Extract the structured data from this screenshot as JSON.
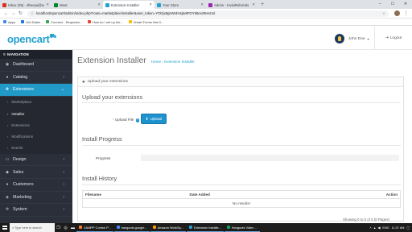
{
  "browser": {
    "tabs": [
      {
        "title": "Inbox (25) - dheeya@wolfspo",
        "favicon_color": "#d93025",
        "active": false
      },
      {
        "title": "Meet",
        "favicon_color": "#00832d",
        "active": false
      },
      {
        "title": "Extension Installer",
        "favicon_color": "#23a1d1",
        "active": true
      },
      {
        "title": "Your Store",
        "favicon_color": "#23a1d1",
        "active": false
      },
      {
        "title": "Admin - InvisiReferrals",
        "favicon_color": "#9c27b0",
        "active": false
      }
    ],
    "url": "localhost/opencart/admin/index.php?route=marketplace/installer&user_token=YOlzjx8gmW4Hsjtu9FOY36exz9HeCel",
    "bookmarks": [
      {
        "label": "Apps",
        "color": "#4285f4"
      },
      {
        "label": "Get Dates",
        "color": "#1a73e8"
      },
      {
        "label": "Connect - Requesta...",
        "color": "#34a853"
      },
      {
        "label": "How do I set up the...",
        "color": "#ea4335"
      },
      {
        "label": "Smart Forms that li...",
        "color": "#fbbc05"
      }
    ]
  },
  "header": {
    "logo_text": "opencart",
    "user_name": "John Doe",
    "logout_label": "Logout"
  },
  "sidebar": {
    "heading": "NAVIGATION",
    "items_top": [
      {
        "label": "Dashboard",
        "icon": "dashboard-icon",
        "glyph": "◉",
        "has_children": false
      },
      {
        "label": "Catalog",
        "icon": "tag-icon",
        "glyph": "●",
        "has_children": true
      }
    ],
    "active_item": {
      "label": "Extensions",
      "icon": "puzzle-icon",
      "glyph": "✚"
    },
    "sub_items": [
      {
        "label": "Marketplace",
        "current": false
      },
      {
        "label": "Installer",
        "current": true
      },
      {
        "label": "Extensions",
        "current": false
      },
      {
        "label": "Modifications",
        "current": false
      },
      {
        "label": "Events",
        "current": false
      }
    ],
    "items_bottom": [
      {
        "label": "Design",
        "icon": "desktop-icon",
        "glyph": "▭"
      },
      {
        "label": "Sales",
        "icon": "cart-icon",
        "glyph": "◆"
      },
      {
        "label": "Customers",
        "icon": "user-icon",
        "glyph": "●"
      },
      {
        "label": "Marketing",
        "icon": "share-icon",
        "glyph": "◈"
      },
      {
        "label": "System",
        "icon": "cog-icon",
        "glyph": "✲"
      }
    ]
  },
  "page": {
    "title": "Extension Installer",
    "breadcrumb_home": "Home",
    "breadcrumb_sep": "›",
    "breadcrumb_current": "Extension Installer",
    "panel_heading": "Upload your extensions",
    "upload_section_title": "Upload your extensions",
    "upload_label": "Upload File",
    "upload_required_mark": "*",
    "upload_button": "Upload",
    "progress_section_title": "Install Progress",
    "progress_label": "Progress",
    "progress_value": 0,
    "history_section_title": "Install History",
    "history_columns": {
      "filename": "Filename",
      "date_added": "Date Added",
      "action": "Action"
    },
    "history_empty": "No results!",
    "paging_text": "Showing 0 to 0 of 0 (0 Pages)"
  },
  "taskbar": {
    "search_placeholder": "Type here to search",
    "apps": [
      {
        "label": "XAMPP Control P...",
        "color": "#fb7a24"
      },
      {
        "label": "hangouts.google...",
        "color": "#4285f4"
      },
      {
        "label": "Amazon WorkSp...",
        "color": "#ff9900"
      },
      {
        "label": "Extension Installe...",
        "color": "#23a1d1"
      },
      {
        "label": "Hangouts Video ...",
        "color": "#0f9d58"
      }
    ],
    "lang": "ENG",
    "time": "11:37 AM"
  }
}
